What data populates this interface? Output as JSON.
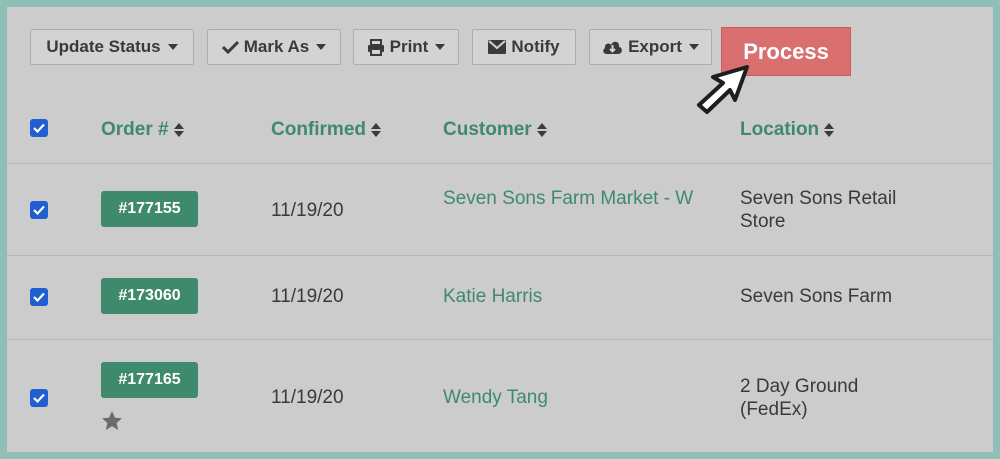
{
  "toolbar": {
    "update_status": "Update Status",
    "mark_as": "Mark As",
    "print": "Print",
    "notify": "Notify",
    "export": "Export",
    "process": "Process"
  },
  "columns": {
    "order": "Order #",
    "confirmed": "Confirmed",
    "customer": "Customer",
    "location": "Location"
  },
  "rows": [
    {
      "order": "#177155",
      "confirmed": "11/19/20",
      "customer": "Seven Sons Farm Market - W",
      "location": "Seven Sons Retail Store",
      "checked": true
    },
    {
      "order": "#173060",
      "confirmed": "11/19/20",
      "customer": "Katie Harris",
      "location": "Seven Sons Farm",
      "checked": true
    },
    {
      "order": "#177165",
      "confirmed": "11/19/20",
      "customer": "Wendy Tang",
      "location": "2 Day Ground (FedEx)",
      "checked": true,
      "starred": true
    }
  ],
  "colors": {
    "accent": "#3f8a6c",
    "process": "#d96f6f",
    "checkbox": "#1f5fd1",
    "frame": "#8fbfb6"
  }
}
